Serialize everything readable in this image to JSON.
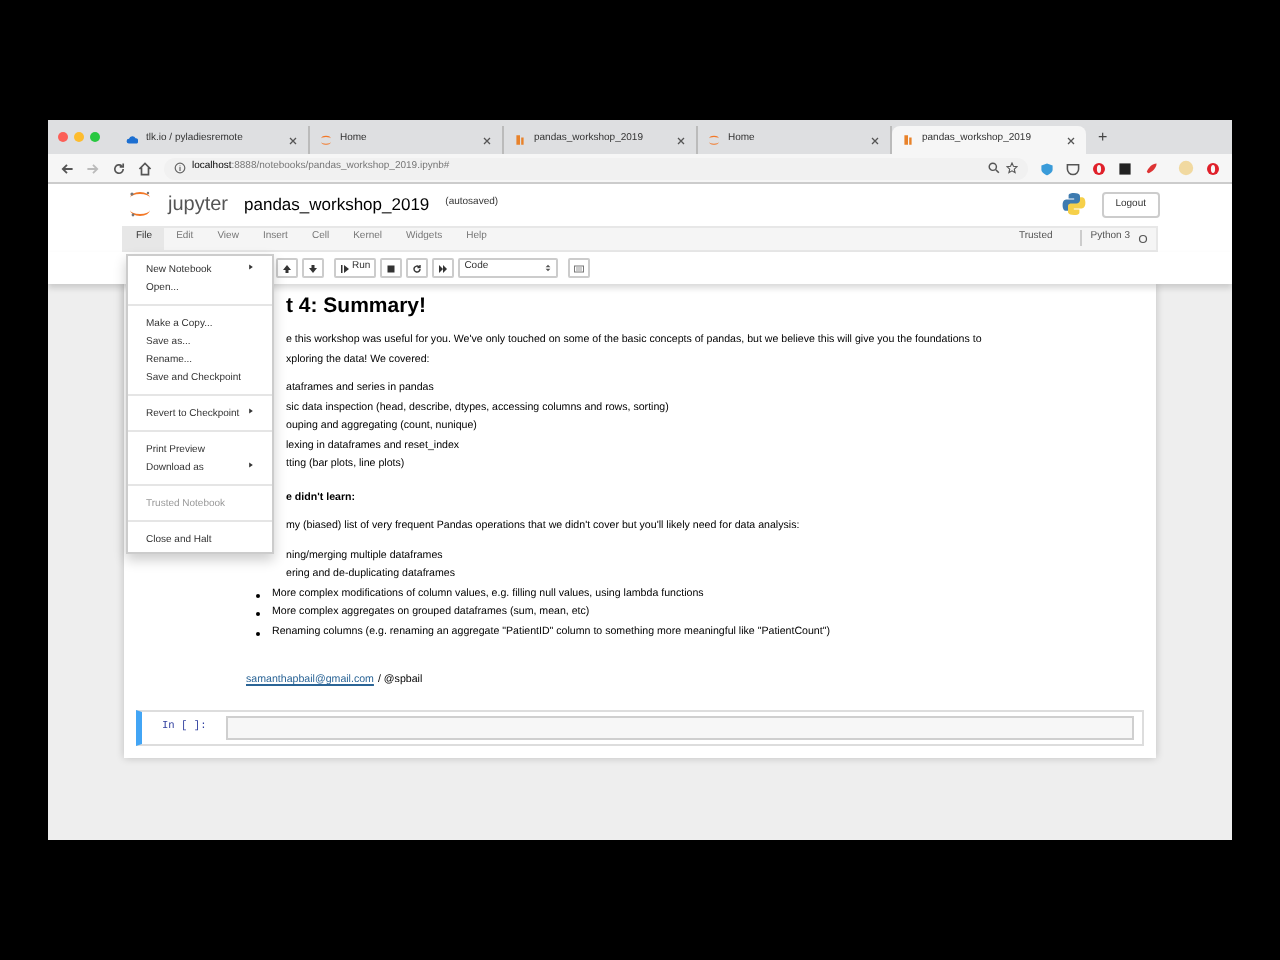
{
  "browser": {
    "tabs": [
      {
        "title": "tlk.io / pyladiesremote",
        "kind": "cloud",
        "selected": false
      },
      {
        "title": "Home",
        "kind": "jupyter",
        "selected": false
      },
      {
        "title": "pandas_workshop_2019",
        "kind": "pandas",
        "selected": false
      },
      {
        "title": "Home",
        "kind": "jupyter",
        "selected": false
      },
      {
        "title": "pandas_workshop_2019",
        "kind": "pandas",
        "selected": true
      }
    ],
    "new_tab": "+",
    "address_host": "localhost",
    "address_rest": ":8888/notebooks/pandas_workshop_2019.ipynb#"
  },
  "notebook": {
    "logo": "jupyter",
    "title": "pandas_workshop_2019",
    "save_status": "(autosaved)",
    "logout": "Logout",
    "menus": [
      {
        "label": "File",
        "selected": true
      },
      {
        "label": "Edit",
        "selected": false
      },
      {
        "label": "View",
        "selected": false
      },
      {
        "label": "Insert",
        "selected": false
      },
      {
        "label": "Cell",
        "selected": false
      },
      {
        "label": "Kernel",
        "selected": false
      },
      {
        "label": "Widgets",
        "selected": false
      },
      {
        "label": "Help",
        "selected": false
      }
    ],
    "trusted": "Trusted",
    "kernel": "Python 3"
  },
  "toolbar": {
    "run": "Run",
    "cell_type": "Code"
  },
  "file_menu": [
    {
      "kind": "item",
      "label": "New Notebook",
      "submenu": true,
      "disabled": false
    },
    {
      "kind": "item",
      "label": "Open...",
      "submenu": false,
      "disabled": false
    },
    {
      "kind": "divider"
    },
    {
      "kind": "item",
      "label": "Make a Copy...",
      "submenu": false,
      "disabled": false
    },
    {
      "kind": "item",
      "label": "Save as...",
      "submenu": false,
      "disabled": false
    },
    {
      "kind": "item",
      "label": "Rename...",
      "submenu": false,
      "disabled": false
    },
    {
      "kind": "item",
      "label": "Save and Checkpoint",
      "submenu": false,
      "disabled": false
    },
    {
      "kind": "divider"
    },
    {
      "kind": "item",
      "label": "Revert to Checkpoint",
      "submenu": true,
      "disabled": false
    },
    {
      "kind": "divider"
    },
    {
      "kind": "item",
      "label": "Print Preview",
      "submenu": false,
      "disabled": false
    },
    {
      "kind": "item",
      "label": "Download as",
      "submenu": true,
      "disabled": false
    },
    {
      "kind": "divider"
    },
    {
      "kind": "item",
      "label": "Trusted Notebook",
      "submenu": false,
      "disabled": true
    },
    {
      "kind": "divider"
    },
    {
      "kind": "item",
      "label": "Close and Halt",
      "submenu": false,
      "disabled": false
    }
  ],
  "cell": {
    "lines": [
      {
        "kind": "heading",
        "text": "t 4: Summary!"
      },
      {
        "kind": "fragment",
        "text": "e this workshop was useful for you. We've only touched on some of the basic concepts of pandas, but we believe this will give you the foundations to"
      },
      {
        "kind": "fragment",
        "text": "xploring the data! We covered:"
      },
      {
        "kind": "gap"
      },
      {
        "kind": "fragment",
        "text": "ataframes and series in pandas"
      },
      {
        "kind": "fragment",
        "text": "sic data inspection (head, describe, dtypes, accessing columns and rows, sorting)"
      },
      {
        "kind": "fragment",
        "text": "ouping and aggregating (count, nunique)"
      },
      {
        "kind": "fragment",
        "text": "lexing in dataframes and reset_index"
      },
      {
        "kind": "fragment",
        "text": "tting (bar plots, line plots)"
      },
      {
        "kind": "gap"
      },
      {
        "kind": "bold",
        "text": "e didn't learn:"
      },
      {
        "kind": "gap"
      },
      {
        "kind": "fragment",
        "text": "my (biased) list of very frequent Pandas operations that we didn't cover but you'll likely need for data analysis:"
      },
      {
        "kind": "gap"
      },
      {
        "kind": "fragment",
        "text": "ning/merging multiple dataframes"
      },
      {
        "kind": "fragment",
        "text": "ering and de-duplicating dataframes"
      },
      {
        "kind": "bullet",
        "text": "More complex modifications of column values, e.g. filling null values, using lambda functions"
      },
      {
        "kind": "bullet",
        "text": "More complex aggregates on grouped dataframes (sum, mean, etc)"
      },
      {
        "kind": "bullet",
        "text": "Renaming columns (e.g. renaming an aggregate \"PatientID\" column to something more meaningful like \"PatientCount\")"
      }
    ],
    "link": "samanthapbail@gmail.com",
    "handle": "/ @spbail"
  },
  "code_cell": {
    "prompt": "In [ ]:"
  }
}
